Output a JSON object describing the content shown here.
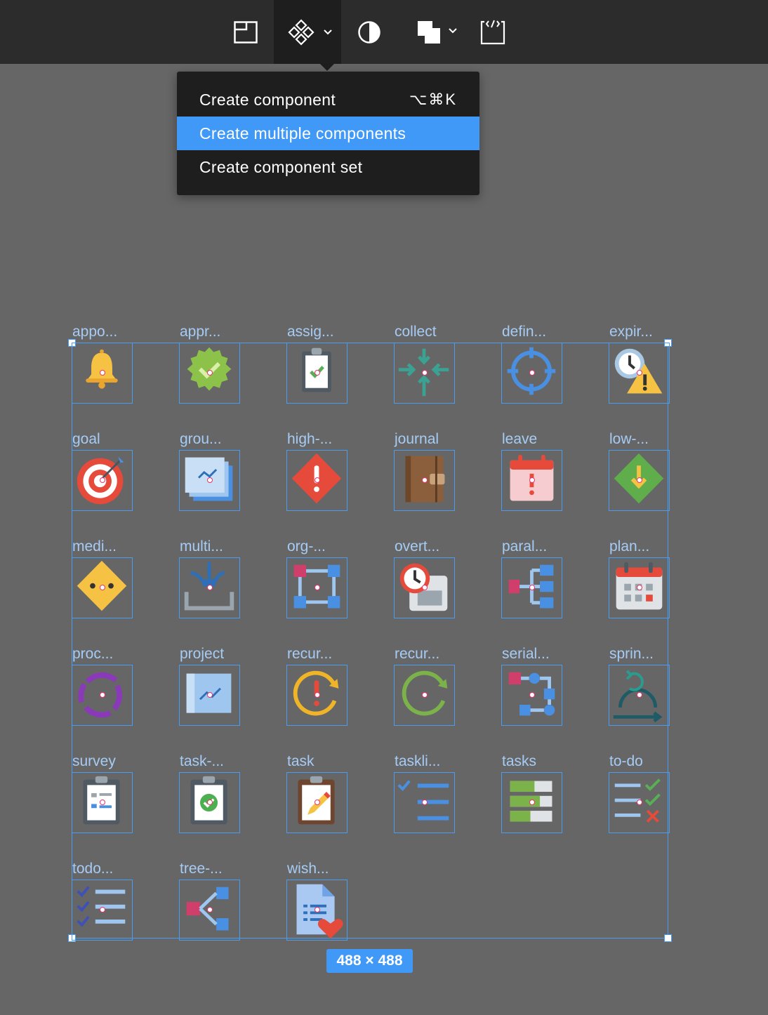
{
  "menu": {
    "items": [
      {
        "label": "Create component",
        "shortcut": "⌥⌘K"
      },
      {
        "label": "Create multiple components",
        "shortcut": ""
      },
      {
        "label": "Create component set",
        "shortcut": ""
      }
    ],
    "selected_index": 1
  },
  "toolbar": {
    "icons": [
      "frame-icon",
      "component-icon",
      "mask-icon",
      "boolean-ops-icon",
      "code-icon"
    ]
  },
  "selection": {
    "size_label": "488 × 488"
  },
  "grid": {
    "cells": [
      {
        "label": "appo...",
        "icon": "bell-icon"
      },
      {
        "label": "appr...",
        "icon": "approved-badge-icon"
      },
      {
        "label": "assig...",
        "icon": "clipboard-check-icon"
      },
      {
        "label": "collect",
        "icon": "collect-arrows-icon"
      },
      {
        "label": "defin...",
        "icon": "crosshair-icon"
      },
      {
        "label": "expir...",
        "icon": "clock-warning-icon"
      },
      {
        "label": "goal",
        "icon": "target-icon"
      },
      {
        "label": "grou...",
        "icon": "blueprint-stack-icon"
      },
      {
        "label": "high-...",
        "icon": "high-priority-icon"
      },
      {
        "label": "journal",
        "icon": "journal-icon"
      },
      {
        "label": "leave",
        "icon": "calendar-alert-icon"
      },
      {
        "label": "low-...",
        "icon": "low-priority-icon"
      },
      {
        "label": "medi...",
        "icon": "medium-priority-icon"
      },
      {
        "label": "multi...",
        "icon": "merge-inbox-icon"
      },
      {
        "label": "org-...",
        "icon": "org-nodes-icon"
      },
      {
        "label": "overt...",
        "icon": "overtime-calendar-icon"
      },
      {
        "label": "paral...",
        "icon": "parallel-tree-icon"
      },
      {
        "label": "plan...",
        "icon": "plan-calendar-icon"
      },
      {
        "label": "proc...",
        "icon": "process-cycle-icon"
      },
      {
        "label": "project",
        "icon": "blueprint-icon"
      },
      {
        "label": "recur...",
        "icon": "recurring-warning-icon"
      },
      {
        "label": "recur...",
        "icon": "recurring-icon"
      },
      {
        "label": "serial...",
        "icon": "serial-flow-icon"
      },
      {
        "label": "sprin...",
        "icon": "sprint-icon"
      },
      {
        "label": "survey",
        "icon": "survey-clipboard-icon"
      },
      {
        "label": "task-...",
        "icon": "task-done-clipboard-icon"
      },
      {
        "label": "task",
        "icon": "task-edit-clipboard-icon"
      },
      {
        "label": "taskli...",
        "icon": "tasklist-icon"
      },
      {
        "label": "tasks",
        "icon": "tasks-progress-icon"
      },
      {
        "label": "to-do",
        "icon": "todo-checks-icon"
      },
      {
        "label": "todo...",
        "icon": "todo-list-icon"
      },
      {
        "label": "tree-...",
        "icon": "tree-share-icon"
      },
      {
        "label": "wish...",
        "icon": "wishlist-doc-icon"
      }
    ]
  },
  "colors": {
    "selection_blue": "#4a9cf0",
    "menu_highlight": "#4199f7",
    "canvas": "#666666",
    "toolbar": "#2c2c2c"
  }
}
